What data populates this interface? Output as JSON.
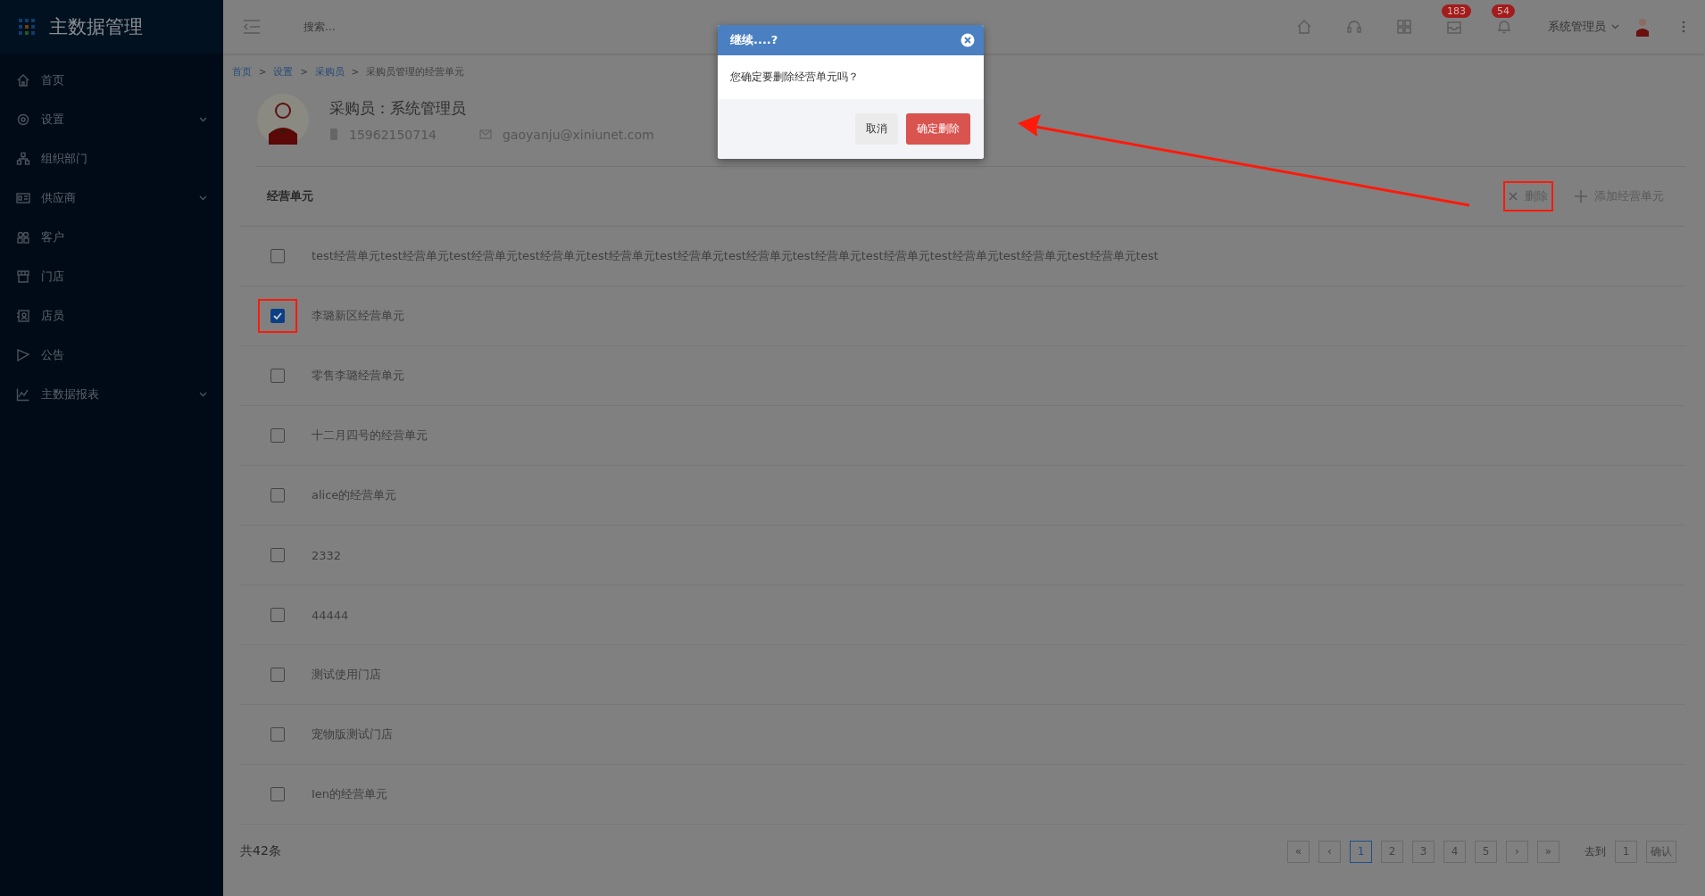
{
  "sidebar": {
    "app_title": "主数据管理",
    "items": [
      {
        "label": "首页",
        "expandable": false
      },
      {
        "label": "设置",
        "expandable": true
      },
      {
        "label": "组织部门",
        "expandable": false
      },
      {
        "label": "供应商",
        "expandable": true
      },
      {
        "label": "客户",
        "expandable": false
      },
      {
        "label": "门店",
        "expandable": false
      },
      {
        "label": "店员",
        "expandable": false
      },
      {
        "label": "公告",
        "expandable": false
      },
      {
        "label": "主数据报表",
        "expandable": true
      }
    ]
  },
  "topbar": {
    "search": {
      "placeholder": "搜索..."
    },
    "inbox_badge": "183",
    "bell_badge": "54",
    "user": "系统管理员"
  },
  "breadcrumb": [
    {
      "label": "首页",
      "link": true
    },
    {
      "separator": ">",
      "label": "设置",
      "link": true
    },
    {
      "separator": ">",
      "label": "采购员",
      "link": true
    },
    {
      "separator": ">",
      "label": "采购员管理的经营单元",
      "link": false
    }
  ],
  "profile": {
    "title": "采购员：系统管理员",
    "phone": "15962150714",
    "email": "gaoyanju@xiniunet.com"
  },
  "section": {
    "title": "经营单元",
    "delete": {
      "label": "删除",
      "highlighted": true
    },
    "add": {
      "label": "添加经营单元"
    }
  },
  "rows": [
    {
      "name": "test经营单元test经营单元test经营单元test经营单元test经营单元test经营单元test经营单元test经营单元test经营单元test经营单元test经营单元test经营单元test",
      "checked": false,
      "highlighted": false
    },
    {
      "name": "李璐新区经营单元",
      "checked": true,
      "highlighted": true
    },
    {
      "name": "零售李璐经营单元",
      "checked": false,
      "highlighted": false
    },
    {
      "name": "十二月四号的经营单元",
      "checked": false,
      "highlighted": false
    },
    {
      "name": "alice的经营单元",
      "checked": false,
      "highlighted": false
    },
    {
      "name": "2332",
      "checked": false,
      "highlighted": false
    },
    {
      "name": "44444",
      "checked": false,
      "highlighted": false
    },
    {
      "name": "测试使用门店",
      "checked": false,
      "highlighted": false
    },
    {
      "name": "宠物版测试门店",
      "checked": false,
      "highlighted": false
    },
    {
      "name": "Ien的经营单元",
      "checked": false,
      "highlighted": false
    }
  ],
  "footer": {
    "total": "共42条",
    "pages": [
      {
        "label": "«",
        "selected": false
      },
      {
        "label": "‹",
        "selected": false
      },
      {
        "label": "1",
        "selected": true
      },
      {
        "label": "2",
        "selected": false
      },
      {
        "label": "3",
        "selected": false
      },
      {
        "label": "4",
        "selected": false
      },
      {
        "label": "5",
        "selected": false
      },
      {
        "label": "›",
        "selected": false
      },
      {
        "label": "»",
        "selected": false
      }
    ],
    "goto_label": "去到",
    "goto_value": "1",
    "confirm": "确认"
  },
  "dialog": {
    "title": "继续....?",
    "message": "您确定要删除经营单元吗？",
    "cancel": "取消",
    "confirm": "确定删除"
  }
}
